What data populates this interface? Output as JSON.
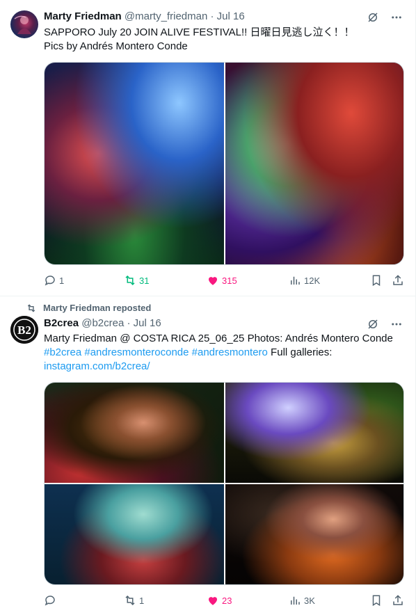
{
  "tweets": [
    {
      "author_name": "Marty Friedman",
      "handle": "@marty_friedman",
      "separator": "·",
      "date": "Jul 16",
      "text_line1": "SAPPORO July 20 JOIN ALIVE FESTIVAL!! 日曜日見逃し泣く！！",
      "text_line2": "Pics by Andrés Montero Conde",
      "stats": {
        "replies": "1",
        "reposts": "31",
        "likes": "315",
        "views": "12K"
      }
    },
    {
      "repost_label": "Marty Friedman reposted",
      "author_name": "B2crea",
      "handle": "@b2crea",
      "separator": "·",
      "date": "Jul 16",
      "text_line1": "Marty Friedman @ COSTA RICA 25_06_25 Photos: Andrés Montero Conde",
      "hashtags": "#b2crea #andresmonteroconde #andresmontero",
      "text_after_hashtags": " Full galleries:",
      "link": "instagram.com/b2crea/",
      "avatar_text": "B2",
      "stats": {
        "replies": "",
        "reposts": "1",
        "likes": "23",
        "views": "3K"
      }
    }
  ],
  "colors": {
    "accent": "#1d9bf0",
    "like": "#f91880",
    "repost": "#00ba7c",
    "muted": "#536471"
  },
  "icons": [
    "grok-icon",
    "more-icon",
    "reply-icon",
    "repost-icon",
    "heart-icon",
    "views-icon",
    "bookmark-icon",
    "share-icon"
  ]
}
